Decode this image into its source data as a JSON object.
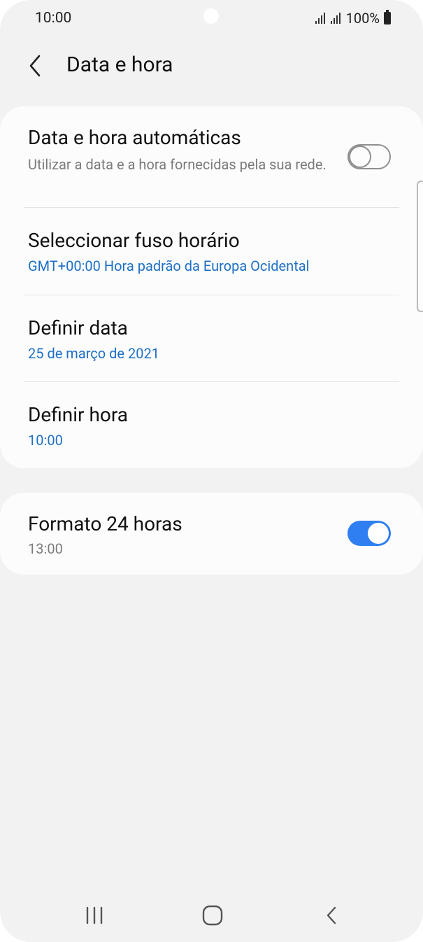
{
  "status_bar": {
    "time": "10:00",
    "battery": "100%",
    "signal_icon": "signal-icon",
    "battery_icon": "battery-icon"
  },
  "header": {
    "title": "Data e hora",
    "back_icon": "chevron-left-icon"
  },
  "settings": {
    "auto_datetime": {
      "title": "Data e hora automáticas",
      "subtitle": "Utilizar a data e a hora fornecidas pela sua rede.",
      "toggle_state": "off"
    },
    "timezone": {
      "title": "Seleccionar fuso horário",
      "value": "GMT+00:00 Hora padrão da Europa Ocidental"
    },
    "set_date": {
      "title": "Definir data",
      "value": "25 de março de 2021"
    },
    "set_time": {
      "title": "Definir hora",
      "value": "10:00"
    },
    "format_24h": {
      "title": "Formato 24 horas",
      "subtitle": "13:00",
      "toggle_state": "on"
    }
  },
  "nav_bar": {
    "recents_icon": "recents-icon",
    "home_icon": "home-icon",
    "back_icon": "back-icon"
  },
  "colors": {
    "accent": "#2f7ff2",
    "link": "#1d6fc6",
    "background": "#f2f2f2",
    "card": "#fcfcfc"
  }
}
